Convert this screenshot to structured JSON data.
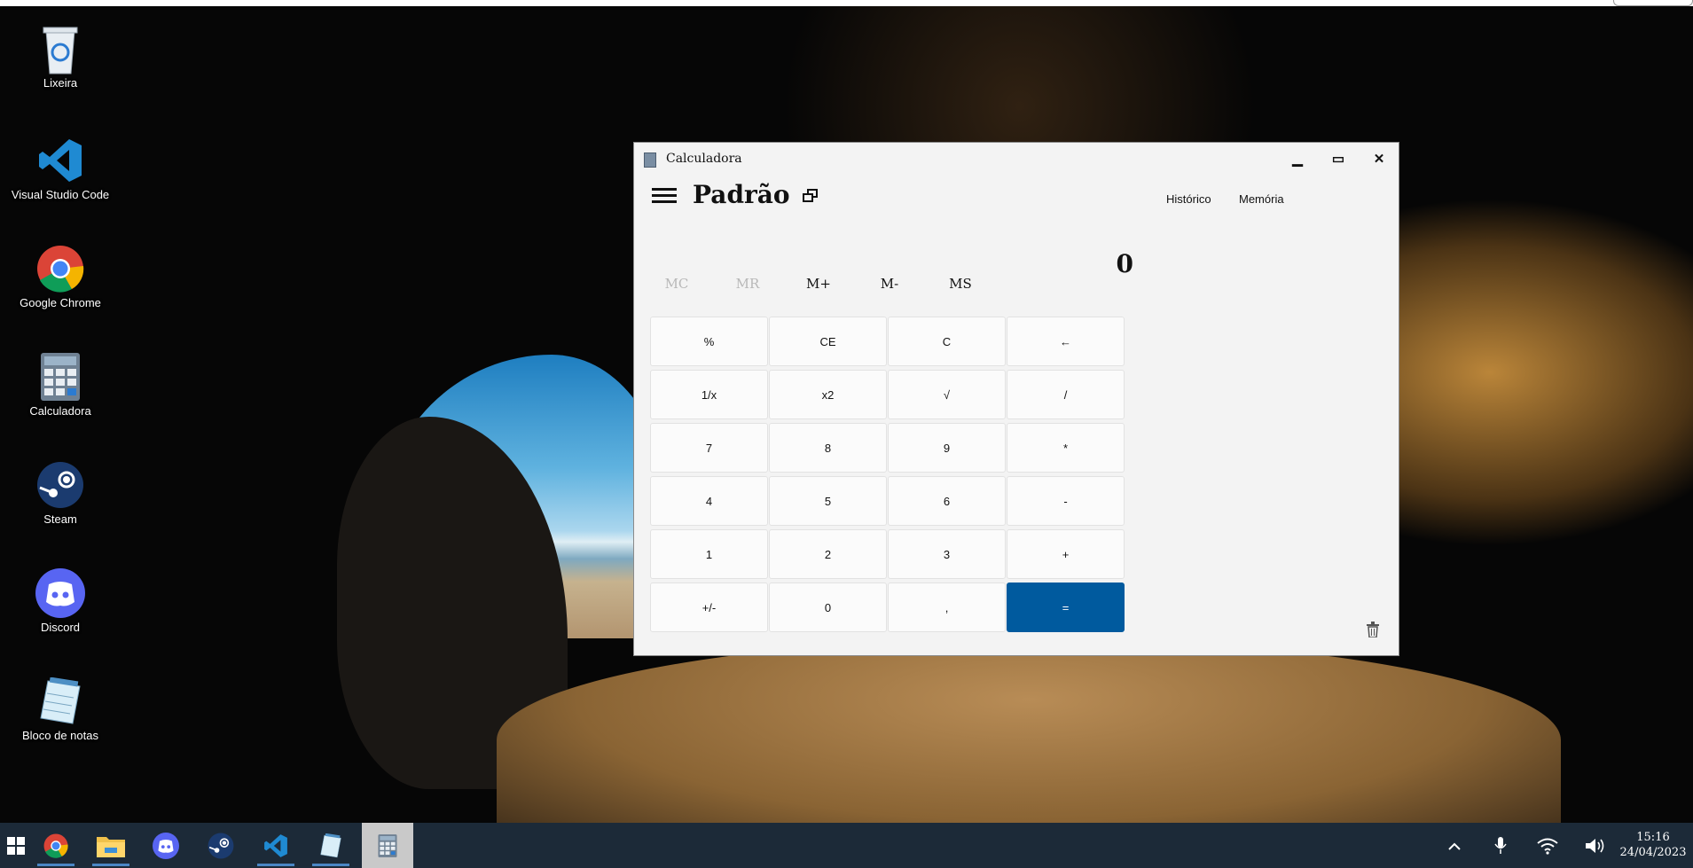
{
  "desktop": {
    "icons": [
      {
        "label": "Lixeira"
      },
      {
        "label": "Visual Studio Code"
      },
      {
        "label": "Google Chrome"
      },
      {
        "label": "Calculadora"
      },
      {
        "label": "Steam"
      },
      {
        "label": "Discord"
      },
      {
        "label": "Bloco de notas"
      }
    ]
  },
  "window": {
    "title": "Calculadora",
    "minimize_glyph": "▁",
    "maximize_glyph": "▭",
    "close_glyph": "✕"
  },
  "calculator": {
    "mode": "Padrão",
    "history_label": "Histórico",
    "memory_label": "Memória",
    "display_value": "0",
    "memory_buttons": [
      {
        "label": "MC",
        "enabled": false
      },
      {
        "label": "MR",
        "enabled": false
      },
      {
        "label": "M+",
        "enabled": true
      },
      {
        "label": "M-",
        "enabled": true
      },
      {
        "label": "MS",
        "enabled": true
      }
    ],
    "keys": [
      "%",
      "CE",
      "C",
      "←",
      "1/x",
      "x2",
      "√",
      "/",
      "7",
      "8",
      "9",
      "*",
      "4",
      "5",
      "6",
      "-",
      "1",
      "2",
      "3",
      "+",
      "+/-",
      "0",
      ",",
      "="
    ],
    "accent_color": "#005a9e"
  },
  "taskbar": {
    "apps": [
      "start-icon",
      "chrome-icon",
      "file-explorer-icon",
      "discord-icon",
      "steam-icon",
      "vscode-icon",
      "notepad-icon",
      "calculator-icon"
    ],
    "time": "15:16",
    "date": "24/04/2023"
  }
}
